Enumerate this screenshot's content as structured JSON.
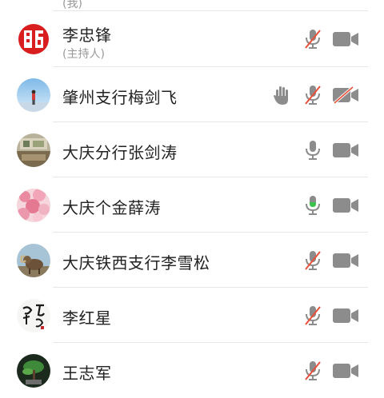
{
  "partial_top": {
    "subtitle": "(我)"
  },
  "participants": [
    {
      "name": "李忠锋",
      "role": "(主持人)",
      "avatar_icon": "red-calligraphy-seal-avatar",
      "hand_raised": false,
      "mic": "muted",
      "camera": "on"
    },
    {
      "name": "肇州支行梅剑飞",
      "avatar_icon": "sky-figure-photo-avatar",
      "hand_raised": true,
      "mic": "muted",
      "camera": "off"
    },
    {
      "name": "大庆分行张剑涛",
      "avatar_icon": "desk-photo-avatar",
      "hand_raised": false,
      "mic": "on",
      "camera": "on"
    },
    {
      "name": "大庆个金薛涛",
      "avatar_icon": "cherry-blossom-avatar",
      "hand_raised": false,
      "mic": "speaking",
      "camera": "on"
    },
    {
      "name": "大庆铁西支行李雪松",
      "avatar_icon": "ram-animal-avatar",
      "hand_raised": false,
      "mic": "muted",
      "camera": "on"
    },
    {
      "name": "李红星",
      "avatar_icon": "ink-calligraphy-avatar",
      "hand_raised": false,
      "mic": "muted",
      "camera": "on"
    },
    {
      "name": "王志军",
      "avatar_icon": "bonsai-tree-avatar",
      "hand_raised": false,
      "mic": "muted",
      "camera": "on"
    }
  ],
  "colors": {
    "icon_gray": "#8c8c8c",
    "mute_slash": "#e8503a",
    "speaking_green": "#3ec24f",
    "divider": "#e6e6e6",
    "name_text": "#222222",
    "sub_text": "#999999"
  }
}
